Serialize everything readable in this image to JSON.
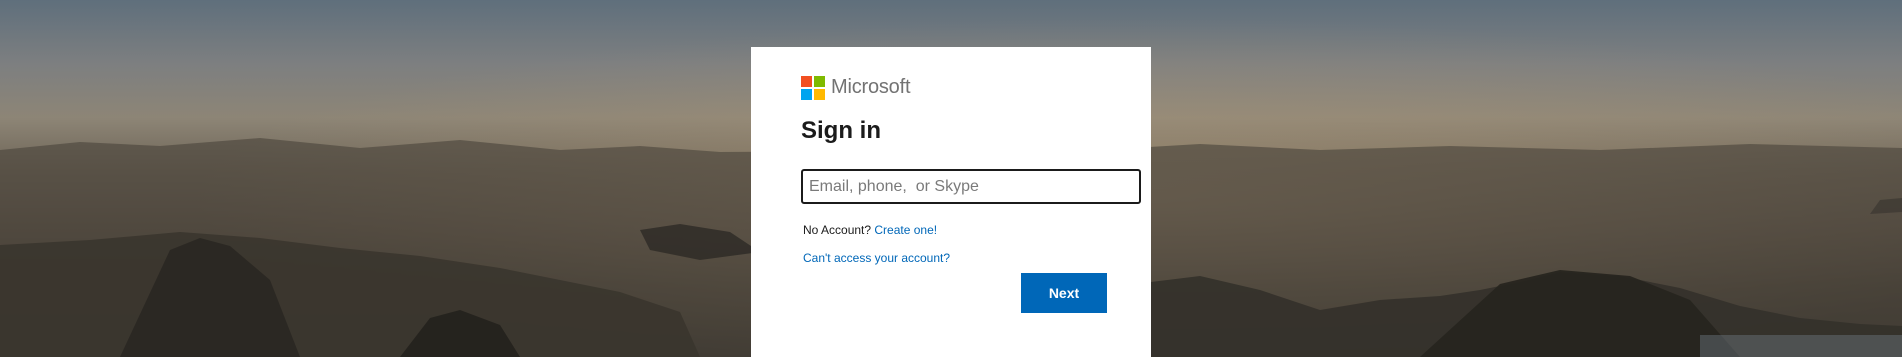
{
  "brand": {
    "name": "Microsoft",
    "logo_colors": [
      "#f25022",
      "#7fba00",
      "#00a4ef",
      "#ffb900"
    ],
    "link_color": "#0067b8"
  },
  "signin": {
    "title": "Sign in",
    "email_placeholder": "Email, phone,  or Skype",
    "email_value": "",
    "no_account_text": "No Account?",
    "create_link": "Create one!",
    "cant_access_link": "Can't access your account?",
    "next_label": "Next"
  }
}
